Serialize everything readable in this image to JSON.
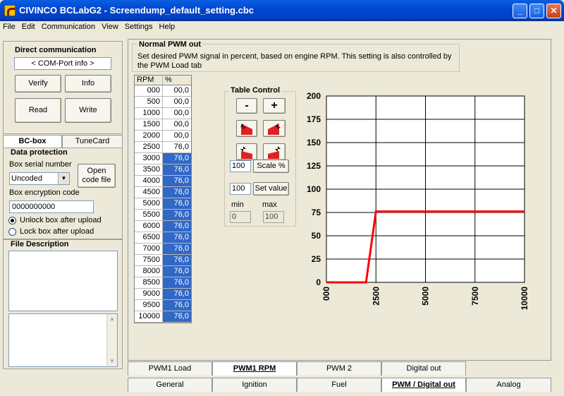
{
  "window": {
    "title": "CIVINCO  BCLabG2 - Screendump_default_setting.cbc"
  },
  "menu": [
    "File",
    "Edit",
    "Communication",
    "View",
    "Settings",
    "Help"
  ],
  "direct_comm": {
    "title": "Direct communication",
    "com_port": "< COM-Port info >",
    "verify": "Verify",
    "info": "Info",
    "read": "Read",
    "write": "Write"
  },
  "left_tabs": {
    "bcbox": "BC-box",
    "tunecard": "TuneCard"
  },
  "data_protection": {
    "title": "Data protection",
    "serial_label": "Box serial number",
    "serial_value": "Uncoded",
    "open_code": "Open code file",
    "encryption_label": "Box encryption code",
    "encryption_value": "0000000000",
    "unlock": "Unlock box after upload",
    "lock": "Lock box after upload"
  },
  "file_description": {
    "title": "File Description"
  },
  "normal_pwm": {
    "title": "Normal PWM out",
    "description": "Set desired PWM signal in percent, based on engine RPM. This setting is also controlled by the PWM Load tab"
  },
  "table": {
    "headers": [
      "RPM",
      "%"
    ],
    "rows": [
      [
        "000",
        "00,0"
      ],
      [
        "500",
        "00,0"
      ],
      [
        "1000",
        "00,0"
      ],
      [
        "1500",
        "00,0"
      ],
      [
        "2000",
        "00,0"
      ],
      [
        "2500",
        "76,0"
      ],
      [
        "3000",
        "76,0"
      ],
      [
        "3500",
        "76,0"
      ],
      [
        "4000",
        "76,0"
      ],
      [
        "4500",
        "76,0"
      ],
      [
        "5000",
        "76,0"
      ],
      [
        "5500",
        "76,0"
      ],
      [
        "6000",
        "76,0"
      ],
      [
        "6500",
        "76,0"
      ],
      [
        "7000",
        "76,0"
      ],
      [
        "7500",
        "76,0"
      ],
      [
        "8000",
        "76,0"
      ],
      [
        "8500",
        "76,0"
      ],
      [
        "9000",
        "76,0"
      ],
      [
        "9500",
        "76,0"
      ],
      [
        "10000",
        "76,0"
      ]
    ],
    "highlight_from": 6
  },
  "table_control": {
    "title": "Table Control",
    "minus": "-",
    "plus": "+",
    "scale_value": "100",
    "scale_label": "Scale %",
    "set_value_input": "100",
    "set_value_label": "Set value",
    "min_label": "min",
    "max_label": "max",
    "min_value": "0",
    "max_value": "100"
  },
  "chart_data": {
    "type": "line",
    "x": [
      0,
      500,
      1000,
      1500,
      2000,
      2500,
      3000,
      3500,
      4000,
      4500,
      5000,
      5500,
      6000,
      6500,
      7000,
      7500,
      8000,
      8500,
      9000,
      9500,
      10000
    ],
    "y": [
      0,
      0,
      0,
      0,
      0,
      76,
      76,
      76,
      76,
      76,
      76,
      76,
      76,
      76,
      76,
      76,
      76,
      76,
      76,
      76,
      76
    ],
    "xlim": [
      0,
      10000
    ],
    "ylim": [
      0,
      200
    ],
    "xticks": [
      "000",
      "2500",
      "5000",
      "7500",
      "10000"
    ],
    "xtick_values": [
      0,
      2500,
      5000,
      7500,
      10000
    ],
    "yticks": [
      "200",
      "175",
      "150",
      "125",
      "100",
      "75",
      "50",
      "25",
      "0"
    ],
    "ytick_values": [
      200,
      175,
      150,
      125,
      100,
      75,
      50,
      25,
      0
    ],
    "grid": true,
    "line_color": "#ff0000"
  },
  "bottom_tabs_row1": [
    "PWM1 Load",
    "PWM1 RPM",
    "PWM 2",
    "Digital out"
  ],
  "bottom_tabs_row2": [
    "General",
    "Ignition",
    "Fuel",
    "PWM / Digital out",
    "Analog"
  ],
  "active": {
    "row1": "PWM1 RPM",
    "row2": "PWM / Digital out"
  }
}
